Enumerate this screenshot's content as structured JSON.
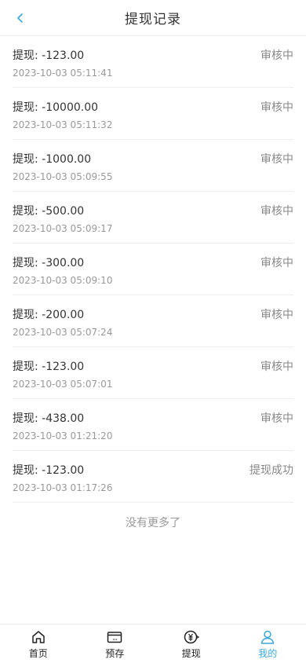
{
  "header": {
    "title": "提现记录"
  },
  "records": [
    {
      "label": "提现: -123.00",
      "time": "2023-10-03 05:11:41",
      "status": "审核中"
    },
    {
      "label": "提现: -10000.00",
      "time": "2023-10-03 05:11:32",
      "status": "审核中"
    },
    {
      "label": "提现: -1000.00",
      "time": "2023-10-03 05:09:55",
      "status": "审核中"
    },
    {
      "label": "提现: -500.00",
      "time": "2023-10-03 05:09:17",
      "status": "审核中"
    },
    {
      "label": "提现: -300.00",
      "time": "2023-10-03 05:09:10",
      "status": "审核中"
    },
    {
      "label": "提现: -200.00",
      "time": "2023-10-03 05:07:24",
      "status": "审核中"
    },
    {
      "label": "提现: -123.00",
      "time": "2023-10-03 05:07:01",
      "status": "审核中"
    },
    {
      "label": "提现: -438.00",
      "time": "2023-10-03 01:21:20",
      "status": "审核中"
    },
    {
      "label": "提现: -123.00",
      "time": "2023-10-03 01:17:26",
      "status": "提现成功"
    }
  ],
  "footer_text": "没有更多了",
  "tabbar": {
    "tabs": [
      {
        "label": "首页",
        "icon": "home-icon",
        "active": false
      },
      {
        "label": "预存",
        "icon": "wallet-icon",
        "active": false
      },
      {
        "label": "提现",
        "icon": "withdraw-icon",
        "active": false
      },
      {
        "label": "我的",
        "icon": "user-icon",
        "active": true
      }
    ]
  },
  "colors": {
    "accent": "#3aa8d6",
    "status": "#888888",
    "text": "#333333"
  }
}
